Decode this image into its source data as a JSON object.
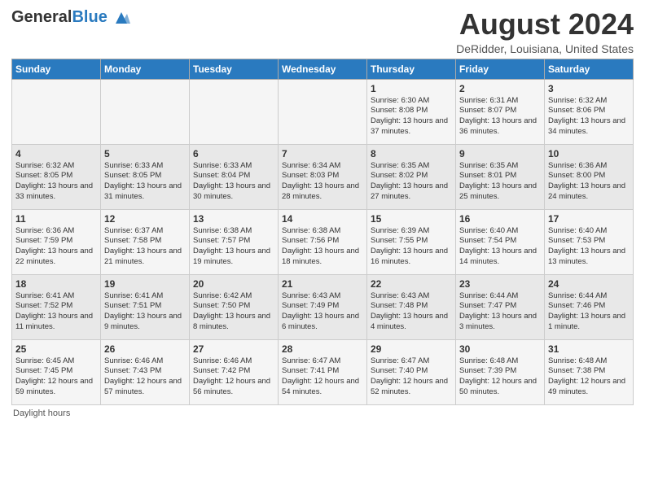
{
  "header": {
    "logo_general": "General",
    "logo_blue": "Blue",
    "main_title": "August 2024",
    "subtitle": "DeRidder, Louisiana, United States"
  },
  "columns": [
    "Sunday",
    "Monday",
    "Tuesday",
    "Wednesday",
    "Thursday",
    "Friday",
    "Saturday"
  ],
  "weeks": [
    [
      {
        "day": "",
        "sunrise": "",
        "sunset": "",
        "daylight": ""
      },
      {
        "day": "",
        "sunrise": "",
        "sunset": "",
        "daylight": ""
      },
      {
        "day": "",
        "sunrise": "",
        "sunset": "",
        "daylight": ""
      },
      {
        "day": "",
        "sunrise": "",
        "sunset": "",
        "daylight": ""
      },
      {
        "day": "1",
        "sunrise": "Sunrise: 6:30 AM",
        "sunset": "Sunset: 8:08 PM",
        "daylight": "Daylight: 13 hours and 37 minutes."
      },
      {
        "day": "2",
        "sunrise": "Sunrise: 6:31 AM",
        "sunset": "Sunset: 8:07 PM",
        "daylight": "Daylight: 13 hours and 36 minutes."
      },
      {
        "day": "3",
        "sunrise": "Sunrise: 6:32 AM",
        "sunset": "Sunset: 8:06 PM",
        "daylight": "Daylight: 13 hours and 34 minutes."
      }
    ],
    [
      {
        "day": "4",
        "sunrise": "Sunrise: 6:32 AM",
        "sunset": "Sunset: 8:05 PM",
        "daylight": "Daylight: 13 hours and 33 minutes."
      },
      {
        "day": "5",
        "sunrise": "Sunrise: 6:33 AM",
        "sunset": "Sunset: 8:05 PM",
        "daylight": "Daylight: 13 hours and 31 minutes."
      },
      {
        "day": "6",
        "sunrise": "Sunrise: 6:33 AM",
        "sunset": "Sunset: 8:04 PM",
        "daylight": "Daylight: 13 hours and 30 minutes."
      },
      {
        "day": "7",
        "sunrise": "Sunrise: 6:34 AM",
        "sunset": "Sunset: 8:03 PM",
        "daylight": "Daylight: 13 hours and 28 minutes."
      },
      {
        "day": "8",
        "sunrise": "Sunrise: 6:35 AM",
        "sunset": "Sunset: 8:02 PM",
        "daylight": "Daylight: 13 hours and 27 minutes."
      },
      {
        "day": "9",
        "sunrise": "Sunrise: 6:35 AM",
        "sunset": "Sunset: 8:01 PM",
        "daylight": "Daylight: 13 hours and 25 minutes."
      },
      {
        "day": "10",
        "sunrise": "Sunrise: 6:36 AM",
        "sunset": "Sunset: 8:00 PM",
        "daylight": "Daylight: 13 hours and 24 minutes."
      }
    ],
    [
      {
        "day": "11",
        "sunrise": "Sunrise: 6:36 AM",
        "sunset": "Sunset: 7:59 PM",
        "daylight": "Daylight: 13 hours and 22 minutes."
      },
      {
        "day": "12",
        "sunrise": "Sunrise: 6:37 AM",
        "sunset": "Sunset: 7:58 PM",
        "daylight": "Daylight: 13 hours and 21 minutes."
      },
      {
        "day": "13",
        "sunrise": "Sunrise: 6:38 AM",
        "sunset": "Sunset: 7:57 PM",
        "daylight": "Daylight: 13 hours and 19 minutes."
      },
      {
        "day": "14",
        "sunrise": "Sunrise: 6:38 AM",
        "sunset": "Sunset: 7:56 PM",
        "daylight": "Daylight: 13 hours and 18 minutes."
      },
      {
        "day": "15",
        "sunrise": "Sunrise: 6:39 AM",
        "sunset": "Sunset: 7:55 PM",
        "daylight": "Daylight: 13 hours and 16 minutes."
      },
      {
        "day": "16",
        "sunrise": "Sunrise: 6:40 AM",
        "sunset": "Sunset: 7:54 PM",
        "daylight": "Daylight: 13 hours and 14 minutes."
      },
      {
        "day": "17",
        "sunrise": "Sunrise: 6:40 AM",
        "sunset": "Sunset: 7:53 PM",
        "daylight": "Daylight: 13 hours and 13 minutes."
      }
    ],
    [
      {
        "day": "18",
        "sunrise": "Sunrise: 6:41 AM",
        "sunset": "Sunset: 7:52 PM",
        "daylight": "Daylight: 13 hours and 11 minutes."
      },
      {
        "day": "19",
        "sunrise": "Sunrise: 6:41 AM",
        "sunset": "Sunset: 7:51 PM",
        "daylight": "Daylight: 13 hours and 9 minutes."
      },
      {
        "day": "20",
        "sunrise": "Sunrise: 6:42 AM",
        "sunset": "Sunset: 7:50 PM",
        "daylight": "Daylight: 13 hours and 8 minutes."
      },
      {
        "day": "21",
        "sunrise": "Sunrise: 6:43 AM",
        "sunset": "Sunset: 7:49 PM",
        "daylight": "Daylight: 13 hours and 6 minutes."
      },
      {
        "day": "22",
        "sunrise": "Sunrise: 6:43 AM",
        "sunset": "Sunset: 7:48 PM",
        "daylight": "Daylight: 13 hours and 4 minutes."
      },
      {
        "day": "23",
        "sunrise": "Sunrise: 6:44 AM",
        "sunset": "Sunset: 7:47 PM",
        "daylight": "Daylight: 13 hours and 3 minutes."
      },
      {
        "day": "24",
        "sunrise": "Sunrise: 6:44 AM",
        "sunset": "Sunset: 7:46 PM",
        "daylight": "Daylight: 13 hours and 1 minute."
      }
    ],
    [
      {
        "day": "25",
        "sunrise": "Sunrise: 6:45 AM",
        "sunset": "Sunset: 7:45 PM",
        "daylight": "Daylight: 12 hours and 59 minutes."
      },
      {
        "day": "26",
        "sunrise": "Sunrise: 6:46 AM",
        "sunset": "Sunset: 7:43 PM",
        "daylight": "Daylight: 12 hours and 57 minutes."
      },
      {
        "day": "27",
        "sunrise": "Sunrise: 6:46 AM",
        "sunset": "Sunset: 7:42 PM",
        "daylight": "Daylight: 12 hours and 56 minutes."
      },
      {
        "day": "28",
        "sunrise": "Sunrise: 6:47 AM",
        "sunset": "Sunset: 7:41 PM",
        "daylight": "Daylight: 12 hours and 54 minutes."
      },
      {
        "day": "29",
        "sunrise": "Sunrise: 6:47 AM",
        "sunset": "Sunset: 7:40 PM",
        "daylight": "Daylight: 12 hours and 52 minutes."
      },
      {
        "day": "30",
        "sunrise": "Sunrise: 6:48 AM",
        "sunset": "Sunset: 7:39 PM",
        "daylight": "Daylight: 12 hours and 50 minutes."
      },
      {
        "day": "31",
        "sunrise": "Sunrise: 6:48 AM",
        "sunset": "Sunset: 7:38 PM",
        "daylight": "Daylight: 12 hours and 49 minutes."
      }
    ]
  ],
  "footer": "Daylight hours"
}
